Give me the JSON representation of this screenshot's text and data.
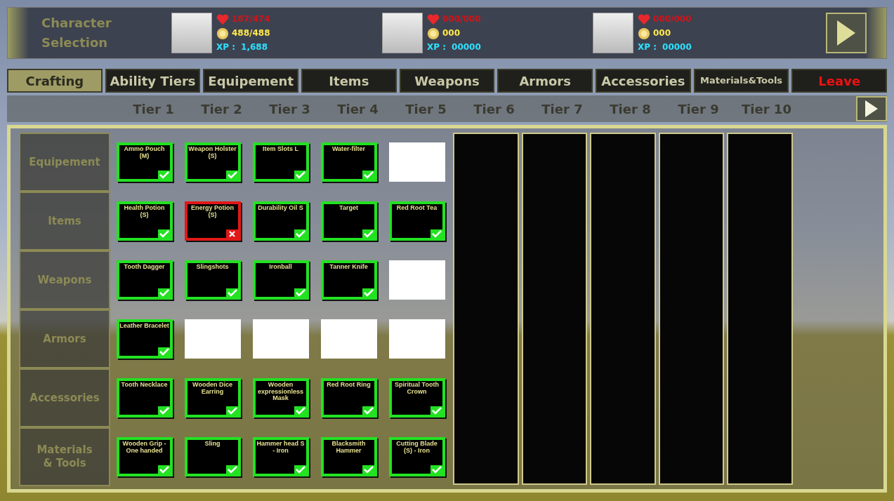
{
  "header": {
    "title": "Character\nSelection"
  },
  "characters": [
    {
      "hp": "187/474",
      "gold": "488/488",
      "xp_label": "XP :",
      "xp": "1,688"
    },
    {
      "hp": "000/000",
      "gold": "000",
      "xp_label": "XP :",
      "xp": "00000"
    },
    {
      "hp": "000/000",
      "gold": "000",
      "xp_label": "XP :",
      "xp": "00000"
    }
  ],
  "tabs": [
    {
      "label": "Crafting",
      "selected": true,
      "kind": "normal"
    },
    {
      "label": "Ability Tiers",
      "selected": false,
      "kind": "normal"
    },
    {
      "label": "Equipement",
      "selected": false,
      "kind": "normal"
    },
    {
      "label": "Items",
      "selected": false,
      "kind": "normal"
    },
    {
      "label": "Weapons",
      "selected": false,
      "kind": "normal"
    },
    {
      "label": "Armors",
      "selected": false,
      "kind": "normal"
    },
    {
      "label": "Accessories",
      "selected": false,
      "kind": "normal"
    },
    {
      "label": "Materials&Tools",
      "selected": false,
      "kind": "small"
    },
    {
      "label": "Leave",
      "selected": false,
      "kind": "leave"
    }
  ],
  "tiers": [
    "Tier 1",
    "Tier 2",
    "Tier 3",
    "Tier 4",
    "Tier 5",
    "Tier 6",
    "Tier 7",
    "Tier 8",
    "Tier 9",
    "Tier 10"
  ],
  "categories": [
    {
      "label": "Equipement",
      "items": [
        {
          "kind": "crafted",
          "label": "Ammo Pouch (M)"
        },
        {
          "kind": "crafted",
          "label": "Weapon Holster (S)"
        },
        {
          "kind": "crafted",
          "label": "Item Slots L"
        },
        {
          "kind": "crafted",
          "label": "Water-filter"
        },
        {
          "kind": "empty"
        }
      ]
    },
    {
      "label": "Items",
      "items": [
        {
          "kind": "crafted",
          "label": "Health Potion (S)"
        },
        {
          "kind": "missing",
          "label": "Energy Potion (S)"
        },
        {
          "kind": "crafted",
          "label": "Durability Oil S"
        },
        {
          "kind": "crafted",
          "label": "Target"
        },
        {
          "kind": "crafted",
          "label": "Red Root Tea"
        }
      ]
    },
    {
      "label": "Weapons",
      "items": [
        {
          "kind": "crafted",
          "label": "Tooth Dagger"
        },
        {
          "kind": "crafted",
          "label": "Slingshots"
        },
        {
          "kind": "crafted",
          "label": "Ironball"
        },
        {
          "kind": "crafted",
          "label": "Tanner Knife"
        },
        {
          "kind": "empty"
        }
      ]
    },
    {
      "label": "Armors",
      "items": [
        {
          "kind": "crafted",
          "label": "Leather Bracelet"
        },
        {
          "kind": "empty"
        },
        {
          "kind": "empty"
        },
        {
          "kind": "empty"
        },
        {
          "kind": "empty"
        }
      ]
    },
    {
      "label": "Accessories",
      "items": [
        {
          "kind": "crafted",
          "label": "Tooth Necklace"
        },
        {
          "kind": "crafted",
          "label": "Wooden Dice Earring"
        },
        {
          "kind": "crafted",
          "label": "Wooden expressionless Mask"
        },
        {
          "kind": "crafted",
          "label": "Red Root Ring"
        },
        {
          "kind": "crafted",
          "label": "Spiritual Tooth Crown"
        }
      ]
    },
    {
      "label": "Materials\n& Tools",
      "items": [
        {
          "kind": "crafted",
          "label": "Wooden Grip - One handed"
        },
        {
          "kind": "crafted",
          "label": "Sling"
        },
        {
          "kind": "crafted",
          "label": "Hammer head S - Iron"
        },
        {
          "kind": "crafted",
          "label": "Blacksmith Hammer"
        },
        {
          "kind": "crafted",
          "label": "Cutting Blade (S) - Iron"
        }
      ]
    }
  ]
}
